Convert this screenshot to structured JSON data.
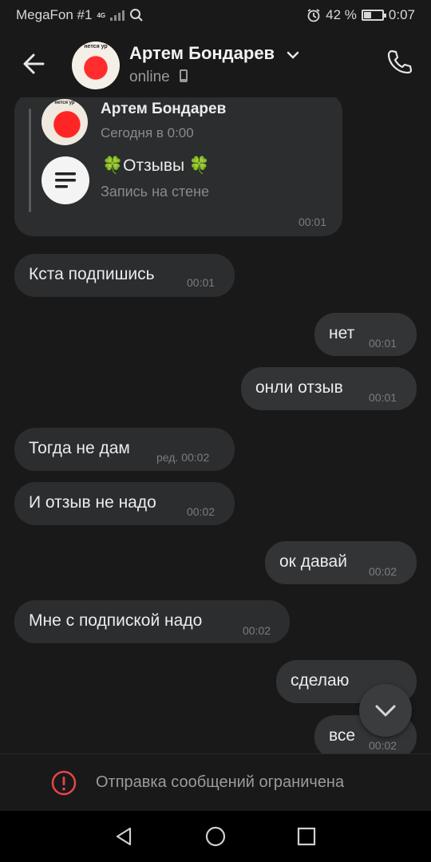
{
  "status_bar": {
    "carrier": "MegaFon #1",
    "network": "4G",
    "battery_percent": "42 %",
    "battery_level": 0.42,
    "time": "0:07"
  },
  "header": {
    "contact_name": "Артем Бондарев",
    "presence": "online",
    "avatar_caption": "нется ур"
  },
  "wall_post": {
    "author": "Артем Бондарев",
    "date": "Сегодня в 0:00",
    "title": "🍀Отзывы 🍀",
    "subtitle": "Запись на стене",
    "time": "00:01",
    "avatar_caption": "нется ур"
  },
  "messages": [
    {
      "dir": "in",
      "text": "Кста подпишись",
      "time": "00:01"
    },
    {
      "dir": "out",
      "text": "нет",
      "time": "00:01"
    },
    {
      "dir": "out",
      "text": "онли отзыв",
      "time": "00:01"
    },
    {
      "dir": "in",
      "text": "Тогда не дам",
      "time": "ред. 00:02"
    },
    {
      "dir": "in",
      "text": "И отзыв не надо",
      "time": "00:02"
    },
    {
      "dir": "out",
      "text": "ок давай",
      "time": "00:02"
    },
    {
      "dir": "in",
      "text": "Мне с подпиской надо",
      "time": "00:02"
    },
    {
      "dir": "out",
      "text": "сделаю",
      "time": ""
    },
    {
      "dir": "out",
      "text": "все",
      "time": "00:02"
    }
  ],
  "restriction_notice": "Отправка сообщений ограничена",
  "icons": {
    "back": "arrow-left-icon",
    "call": "phone-icon",
    "scroll_down": "chevron-down-icon",
    "warning": "exclamation-circle-icon",
    "nav_back": "triangle-back-icon",
    "nav_home": "circle-home-icon",
    "nav_recent": "square-recent-icon"
  },
  "colors": {
    "background": "#19191a",
    "bubble": "#2c2d2e",
    "warning": "#e64646"
  }
}
